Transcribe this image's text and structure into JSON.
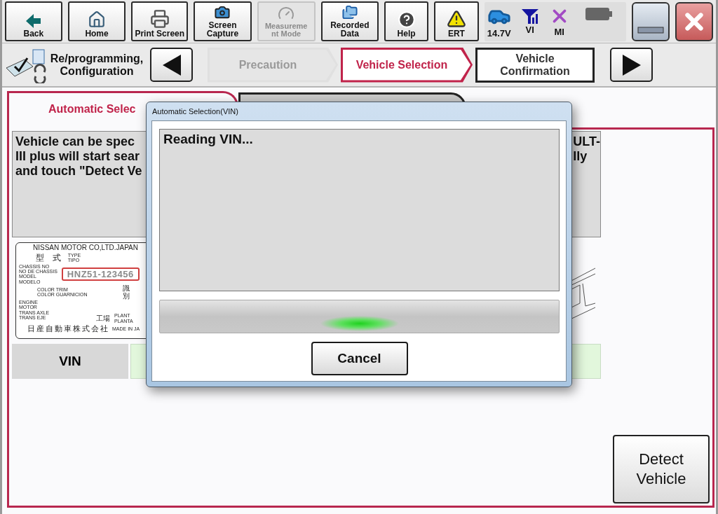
{
  "toolbar": {
    "buttons": [
      {
        "label": "Back",
        "kind": "back",
        "disabled": false
      },
      {
        "label": "Home",
        "kind": "home",
        "disabled": false
      },
      {
        "label": "Print Screen",
        "kind": "printer",
        "disabled": false
      },
      {
        "label": "Screen\nCapture",
        "kind": "camera",
        "disabled": false
      },
      {
        "label": "Measureme\nnt Mode",
        "kind": "meter",
        "disabled": true
      },
      {
        "label": "Recorded\nData",
        "kind": "folders",
        "disabled": false
      },
      {
        "label": "Help",
        "kind": "help",
        "disabled": false
      },
      {
        "label": "ERT",
        "kind": "warning",
        "disabled": false
      }
    ],
    "status": [
      {
        "label": "14.7V",
        "kind": "car"
      },
      {
        "label": "VI",
        "kind": "antenna"
      },
      {
        "label": "MI",
        "kind": "cross"
      }
    ]
  },
  "nav": {
    "module": "Re/programming,\nConfiguration",
    "steps": [
      {
        "label": "Precaution",
        "selected": false,
        "disabled": true
      },
      {
        "label": "Vehicle Selection",
        "selected": true,
        "disabled": false
      },
      {
        "label": "Vehicle\nConfirmation",
        "selected": false,
        "disabled": false
      }
    ]
  },
  "tabs": [
    {
      "label": "Automatic Selec",
      "selected": true
    },
    {
      "selected": false
    }
  ],
  "description": {
    "visible_left": "Vehicle can be spec\nIII plus will start sear\nand touch \"Detect Ve",
    "visible_right": "ULT-\nlly"
  },
  "plate": {
    "maker": "NISSAN MOTOR CO,LTD.JAPAN",
    "type_jp": "型 式",
    "type": "TYPE\nTIPO",
    "chassis_labels": "CHASSIS NO\nNO DE CHASSIS\nMODEL\nMODELO",
    "chassis_no": "HNZ51-123456",
    "trim": "COLOR TRIM\nCOLOR GUARNICION",
    "id_jp": "識別",
    "engine": "ENGINE\nMOTOR\nTRANS AXLE\nTRANS EJE",
    "plant_jp": "工場",
    "plant": "PLANT\nPLANTA",
    "company_jp": "日産自動車株式会社",
    "made_in": "MADE IN JA"
  },
  "vin": {
    "label": "VIN"
  },
  "detect_button": "Detect\nVehicle",
  "dialog": {
    "title": "Automatic Selection(VIN)",
    "message": "Reading VIN...",
    "cancel": "Cancel",
    "progress": {
      "level": 0.5
    }
  }
}
